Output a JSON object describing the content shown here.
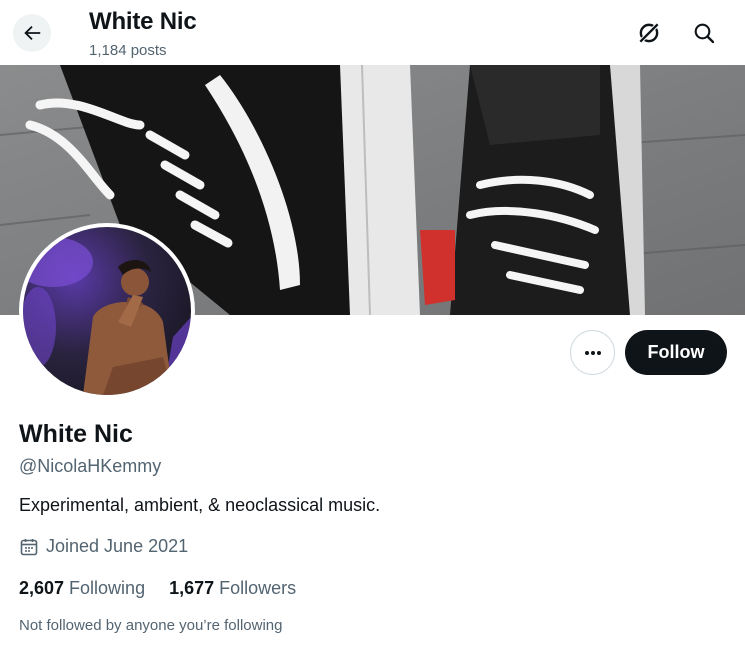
{
  "header": {
    "title": "White Nic",
    "posts_count": "1,184 posts",
    "back_icon": "arrow-left-icon",
    "grok_icon": "grok-icon",
    "search_icon": "search-icon"
  },
  "banner": {
    "description_icon": "banner-image"
  },
  "profile": {
    "display_name": "White Nic",
    "handle": "@NicolaHKemmy",
    "bio": "Experimental, ambient, & neoclassical music.",
    "joined": "Joined June 2021",
    "following_count": "2,607",
    "following_label": "Following",
    "followers_count": "1,677",
    "followers_label": "Followers",
    "follow_note": "Not followed by anyone you’re following"
  },
  "actions": {
    "follow_label": "Follow",
    "more_icon": "more-dots-icon"
  },
  "colors": {
    "text_primary": "#0f1419",
    "text_secondary": "#536471",
    "follow_button_bg": "#0f1419",
    "border": "#cfd9de"
  }
}
